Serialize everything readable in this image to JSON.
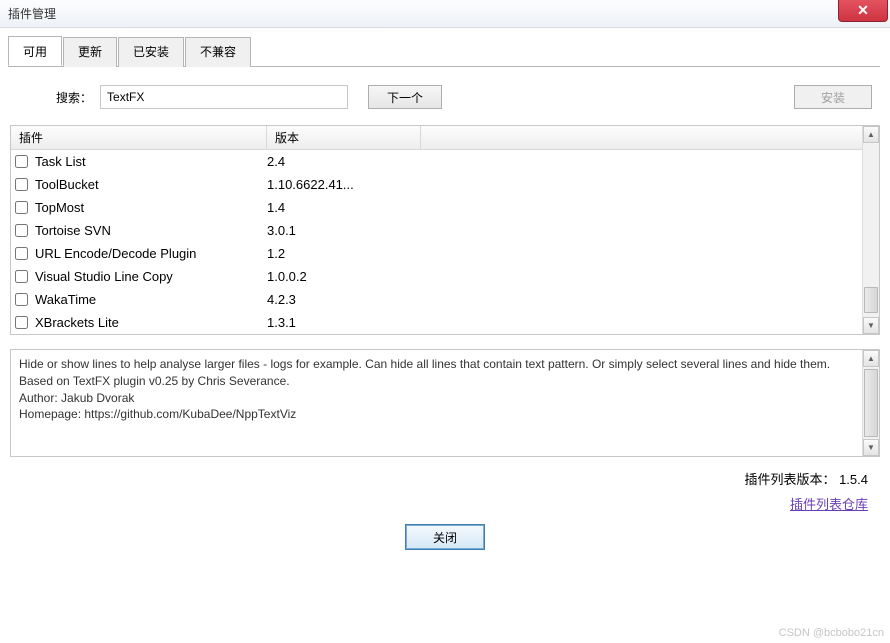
{
  "window": {
    "title": "插件管理"
  },
  "tabs": {
    "available": "可用",
    "updates": "更新",
    "installed": "已安装",
    "incompatible": "不兼容"
  },
  "search": {
    "label": "搜索：",
    "value": "TextFX",
    "next_button": "下一个",
    "install_button": "安装"
  },
  "table": {
    "headers": {
      "plugin": "插件",
      "version": "版本"
    },
    "rows": [
      {
        "name": "Task List",
        "version": "2.4"
      },
      {
        "name": "ToolBucket",
        "version": "1.10.6622.41..."
      },
      {
        "name": "TopMost",
        "version": "1.4"
      },
      {
        "name": "Tortoise SVN",
        "version": "3.0.1"
      },
      {
        "name": "URL Encode/Decode Plugin",
        "version": "1.2"
      },
      {
        "name": "Visual Studio Line Copy",
        "version": "1.0.0.2"
      },
      {
        "name": "WakaTime",
        "version": "4.2.3"
      },
      {
        "name": "XBrackets Lite",
        "version": "1.3.1"
      }
    ]
  },
  "description": "Hide or show lines to help analyse larger files - logs for example. Can hide all lines that contain text pattern. Or simply select several lines and hide them. Based on TextFX plugin v0.25 by Chris Severance.\nAuthor: Jakub Dvorak\nHomepage: https://github.com/KubaDee/NppTextViz",
  "footer": {
    "version_label": "插件列表版本：",
    "version_value": "1.5.4",
    "repo_link": "插件列表仓库",
    "close_button": "关闭"
  },
  "watermark": "CSDN @bcbobo21cn"
}
